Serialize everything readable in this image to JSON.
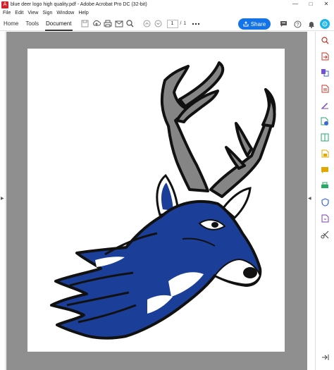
{
  "window": {
    "title": "blue deer logo high quality.pdf - Adobe Acrobat Pro DC (32-bit)",
    "minimize": "—",
    "maximize": "□",
    "close": "✕"
  },
  "menu": [
    "File",
    "Edit",
    "View",
    "Sign",
    "Window",
    "Help"
  ],
  "tabs": {
    "home": "Home",
    "tools": "Tools",
    "document": "Document"
  },
  "page_nav": {
    "current": "1",
    "separator": "/",
    "total": "1"
  },
  "share": {
    "label": "Share"
  },
  "colors": {
    "accent": "#1473e6",
    "deer_blue": "#1b3f99",
    "antler_gray": "#808080"
  },
  "right_rail_icons": [
    "zoom-icon",
    "export-pdf-icon",
    "organize-pages-icon",
    "create-pdf-icon",
    "fill-sign-icon",
    "edit-pdf-icon",
    "compress-icon",
    "protect-icon",
    "comment-icon",
    "print-production-icon",
    "security-shield-icon",
    "more-tools-icon",
    "scissors-icon"
  ]
}
